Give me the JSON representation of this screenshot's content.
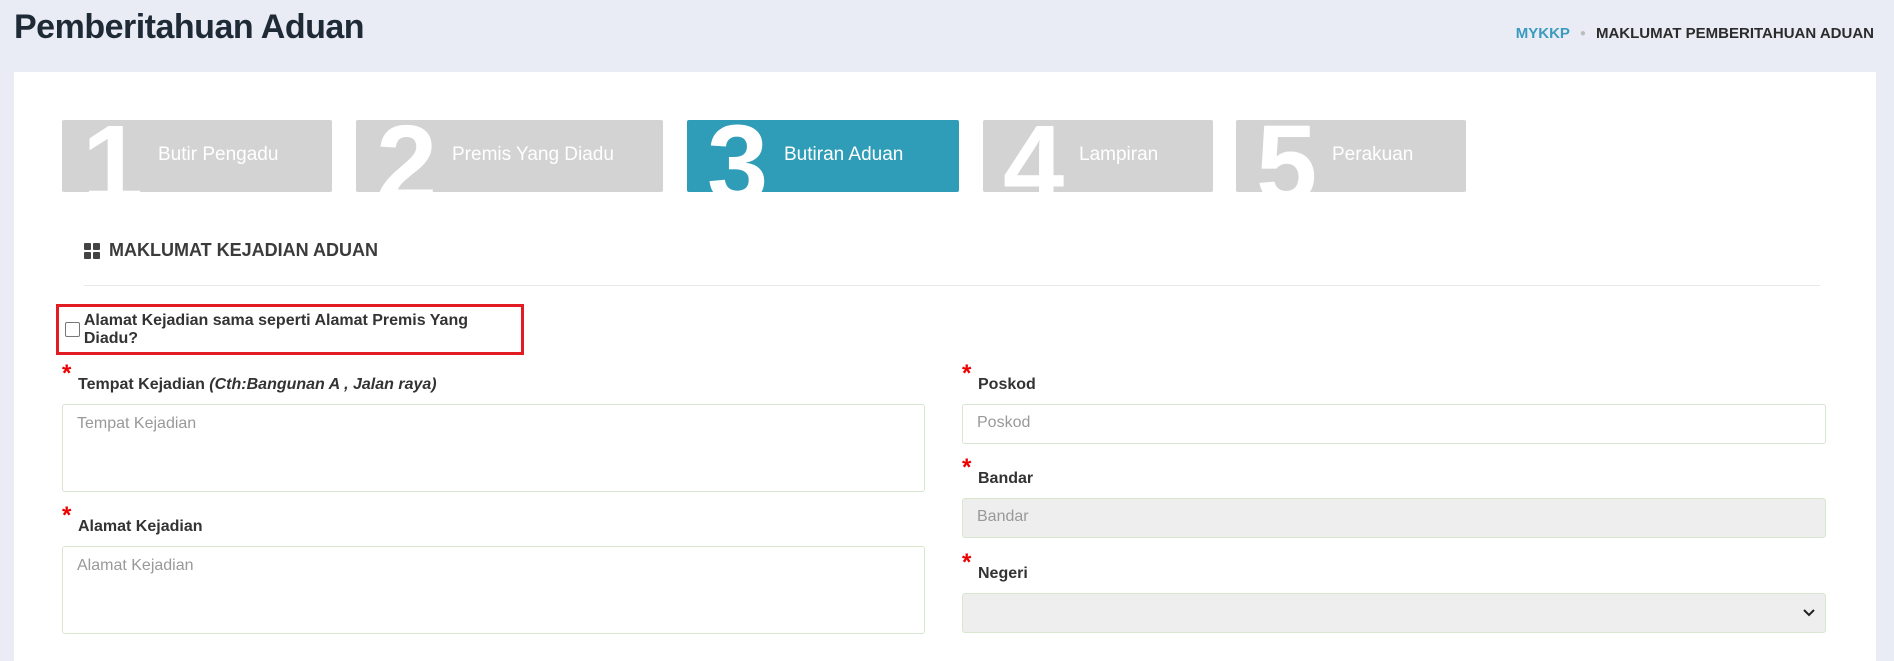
{
  "header": {
    "title": "Pemberitahuan Aduan",
    "breadcrumb": {
      "home": "MYKKP",
      "current": "MAKLUMAT PEMBERITAHUAN ADUAN"
    }
  },
  "steps": [
    {
      "number": "1",
      "label": "Butir Pengadu",
      "active": false
    },
    {
      "number": "2",
      "label": "Premis Yang Diadu",
      "active": false
    },
    {
      "number": "3",
      "label": "Butiran Aduan",
      "active": true
    },
    {
      "number": "4",
      "label": "Lampiran",
      "active": false
    },
    {
      "number": "5",
      "label": "Perakuan",
      "active": false
    }
  ],
  "section": {
    "title": "MAKLUMAT KEJADIAN ADUAN",
    "icon": "grid-icon"
  },
  "same_address": {
    "label": "Alamat Kejadian sama seperti Alamat Premis Yang Diadu?",
    "checked": false
  },
  "form": {
    "required_mark": "*",
    "tempat": {
      "label": "Tempat Kejadian",
      "hint": "(Cth:Bangunan A , Jalan raya)",
      "placeholder": "Tempat Kejadian",
      "value": ""
    },
    "alamat": {
      "label": "Alamat Kejadian",
      "placeholder": "Alamat Kejadian",
      "value": ""
    },
    "poskod": {
      "label": "Poskod",
      "placeholder": "Poskod",
      "value": ""
    },
    "bandar": {
      "label": "Bandar",
      "placeholder": "Bandar",
      "value": ""
    },
    "negeri": {
      "label": "Negeri",
      "selected": ""
    }
  },
  "colors": {
    "active_step": "#2f9db8",
    "inactive_step": "#d3d3d3",
    "highlight_border": "#e31b23",
    "required": "#e00000",
    "breadcrumb_link": "#3a9bbf"
  }
}
